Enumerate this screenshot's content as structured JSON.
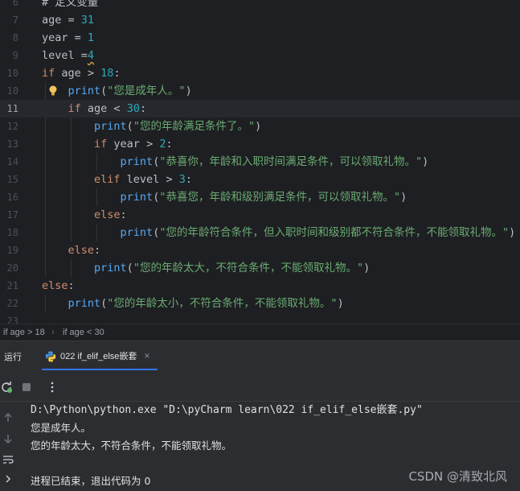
{
  "editor": {
    "lines": [
      {
        "num": "6",
        "tokens": [
          {
            "t": "# 定义变量",
            "c": "tok-var"
          }
        ]
      },
      {
        "num": "7",
        "tokens": [
          {
            "t": "age = ",
            "c": "tok-var"
          },
          {
            "t": "31",
            "c": "tok-num"
          }
        ]
      },
      {
        "num": "8",
        "tokens": [
          {
            "t": "year = ",
            "c": "tok-var"
          },
          {
            "t": "1",
            "c": "tok-num"
          }
        ]
      },
      {
        "num": "9",
        "tokens": [
          {
            "t": "level =",
            "c": "tok-var"
          },
          {
            "t": "4",
            "c": "tok-num warn"
          }
        ]
      },
      {
        "num": "10",
        "tokens": [
          {
            "t": "if",
            "c": "tok-kw"
          },
          {
            "t": " age > ",
            "c": "tok-var"
          },
          {
            "t": "18",
            "c": "tok-num"
          },
          {
            "t": ":",
            "c": "tok-op"
          }
        ]
      },
      {
        "num": "11",
        "tokens": [
          {
            "t": "    ",
            "c": "tok-var"
          },
          {
            "t": "print",
            "c": "tok-fn"
          },
          {
            "t": "(",
            "c": "tok-op"
          },
          {
            "t": "\"您是成年人。\"",
            "c": "tok-str"
          },
          {
            "t": ")",
            "c": "tok-op"
          }
        ]
      },
      {
        "num": "11",
        "tokens": [
          {
            "t": "    ",
            "c": "tok-var"
          },
          {
            "t": "if",
            "c": "tok-kw"
          },
          {
            "t": " age < ",
            "c": "tok-var"
          },
          {
            "t": "30",
            "c": "tok-num"
          },
          {
            "t": ":",
            "c": "tok-op"
          }
        ]
      },
      {
        "num": "12",
        "tokens": [
          {
            "t": "        ",
            "c": "tok-var"
          },
          {
            "t": "print",
            "c": "tok-fn"
          },
          {
            "t": "(",
            "c": "tok-op"
          },
          {
            "t": "\"您的年龄满足条件了。\"",
            "c": "tok-str"
          },
          {
            "t": ")",
            "c": "tok-op"
          }
        ]
      },
      {
        "num": "13",
        "tokens": [
          {
            "t": "        ",
            "c": "tok-var"
          },
          {
            "t": "if",
            "c": "tok-kw"
          },
          {
            "t": " year > ",
            "c": "tok-var"
          },
          {
            "t": "2",
            "c": "tok-num"
          },
          {
            "t": ":",
            "c": "tok-op"
          }
        ]
      },
      {
        "num": "14",
        "tokens": [
          {
            "t": "            ",
            "c": "tok-var"
          },
          {
            "t": "print",
            "c": "tok-fn"
          },
          {
            "t": "(",
            "c": "tok-op"
          },
          {
            "t": "\"恭喜你，年龄和入职时间满足条件，可以领取礼物。\"",
            "c": "tok-str"
          },
          {
            "t": ")",
            "c": "tok-op"
          }
        ]
      },
      {
        "num": "15",
        "tokens": [
          {
            "t": "        ",
            "c": "tok-var"
          },
          {
            "t": "elif",
            "c": "tok-kw"
          },
          {
            "t": " level > ",
            "c": "tok-var"
          },
          {
            "t": "3",
            "c": "tok-num"
          },
          {
            "t": ":",
            "c": "tok-op"
          }
        ]
      },
      {
        "num": "16",
        "tokens": [
          {
            "t": "            ",
            "c": "tok-var"
          },
          {
            "t": "print",
            "c": "tok-fn"
          },
          {
            "t": "(",
            "c": "tok-op"
          },
          {
            "t": "\"恭喜您，年龄和级别满足条件，可以领取礼物。\"",
            "c": "tok-str"
          },
          {
            "t": ")",
            "c": "tok-op"
          }
        ]
      },
      {
        "num": "17",
        "tokens": [
          {
            "t": "        ",
            "c": "tok-var"
          },
          {
            "t": "else",
            "c": "tok-kw"
          },
          {
            "t": ":",
            "c": "tok-op"
          }
        ]
      },
      {
        "num": "18",
        "tokens": [
          {
            "t": "            ",
            "c": "tok-var"
          },
          {
            "t": "print",
            "c": "tok-fn"
          },
          {
            "t": "(",
            "c": "tok-op"
          },
          {
            "t": "\"您的年龄符合条件，但入职时间和级别都不符合条件，不能领取礼物。\"",
            "c": "tok-str"
          },
          {
            "t": ")",
            "c": "tok-op"
          }
        ]
      },
      {
        "num": "19",
        "tokens": [
          {
            "t": "    ",
            "c": "tok-var"
          },
          {
            "t": "else",
            "c": "tok-kw"
          },
          {
            "t": ":",
            "c": "tok-op"
          }
        ]
      },
      {
        "num": "20",
        "tokens": [
          {
            "t": "        ",
            "c": "tok-var"
          },
          {
            "t": "print",
            "c": "tok-fn"
          },
          {
            "t": "(",
            "c": "tok-op"
          },
          {
            "t": "\"您的年龄太大，不符合条件，不能领取礼物。\"",
            "c": "tok-str"
          },
          {
            "t": ")",
            "c": "tok-op"
          }
        ]
      },
      {
        "num": "21",
        "tokens": [
          {
            "t": "else",
            "c": "tok-kw"
          },
          {
            "t": ":",
            "c": "tok-op"
          }
        ]
      },
      {
        "num": "22",
        "tokens": [
          {
            "t": "    ",
            "c": "tok-var"
          },
          {
            "t": "print",
            "c": "tok-fn"
          },
          {
            "t": "(",
            "c": "tok-op"
          },
          {
            "t": "\"您的年龄太小，不符合条件，不能领取礼物。\"",
            "c": "tok-str"
          },
          {
            "t": ")",
            "c": "tok-op"
          }
        ]
      },
      {
        "num": "23",
        "tokens": []
      }
    ],
    "line_numbers_display": [
      "6",
      "7",
      "8",
      "9",
      "10",
      "10",
      "11",
      "12",
      "13",
      "14",
      "15",
      "16",
      "17",
      "18",
      "19",
      "20",
      "21",
      "22",
      "23"
    ]
  },
  "breadcrumb": {
    "items": [
      "if age > 18",
      "if age < 30"
    ],
    "separator": "›"
  },
  "run_panel": {
    "tab_run_label": "运行",
    "file_tab_label": "022 if_elif_else嵌套",
    "close_glyph": "×"
  },
  "console": {
    "lines": [
      "D:\\Python\\python.exe \"D:\\pyCharm learn\\022 if_elif_else嵌套.py\"",
      "您是成年人。",
      "您的年龄太大，不符合条件，不能领取礼物。",
      "",
      "进程已结束，退出代码为 0"
    ]
  },
  "watermark": "CSDN @清致北风",
  "colors": {
    "background": "#1e1f22",
    "keyword": "#cf8e6d",
    "number": "#2aacb8",
    "string": "#6aab73",
    "function": "#56a8f5",
    "accent": "#3574f0"
  }
}
